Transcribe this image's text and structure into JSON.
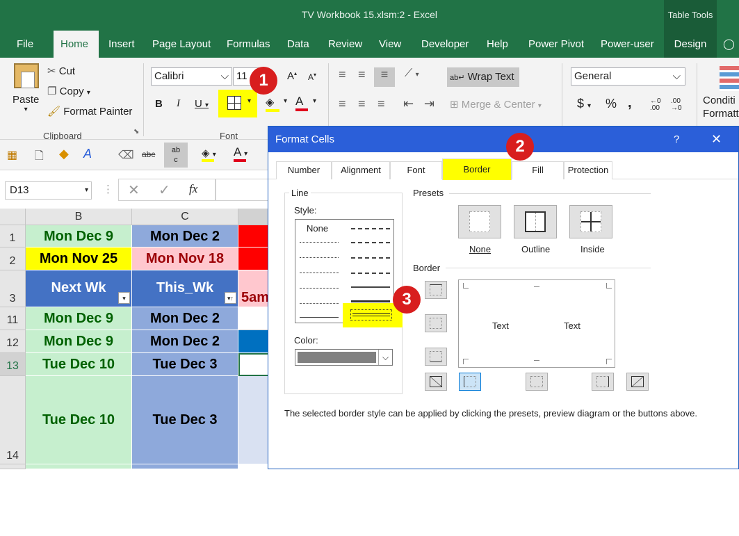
{
  "window": {
    "title": "TV Workbook 15.xlsm:2  -  Excel",
    "table_tools": "Table Tools"
  },
  "tabs": [
    "File",
    "Home",
    "Insert",
    "Page Layout",
    "Formulas",
    "Data",
    "Review",
    "View",
    "Developer",
    "Help",
    "Power Pivot",
    "Power-user",
    "Design"
  ],
  "clipboard": {
    "paste": "Paste",
    "cut": "Cut",
    "copy": "Copy",
    "format_painter": "Format Painter",
    "group": "Clipboard"
  },
  "font": {
    "name": "Calibri",
    "size": "11",
    "group": "Font"
  },
  "alignment": {
    "wrap_text": "Wrap Text",
    "merge_center": "Merge & Center"
  },
  "number": {
    "format": "General",
    "symbols": [
      "$",
      "%",
      ","
    ]
  },
  "styles": {
    "conditional": "Conditional Formatting",
    "cond_line1": "Conditi",
    "cond_line2": "Formatti"
  },
  "formula_bar": {
    "name_box": "D13",
    "fx": "fx"
  },
  "sheet": {
    "columns": [
      "B",
      "C"
    ],
    "rows": [
      {
        "num": "1",
        "b": "Mon Dec 9",
        "c": "Mon Dec 2"
      },
      {
        "num": "2",
        "b": "Mon Nov 25",
        "c": "Mon Nov 18"
      },
      {
        "num": "3",
        "b": "Next Wk",
        "c": "This_Wk",
        "d": "5am"
      },
      {
        "num": "11",
        "b": "Mon Dec 9",
        "c": "Mon Dec 2"
      },
      {
        "num": "12",
        "b": "Mon Dec 9",
        "c": "Mon Dec 2"
      },
      {
        "num": "13",
        "b": "Tue Dec 10",
        "c": "Tue Dec 3"
      },
      {
        "num": "14",
        "b": "Tue Dec 10",
        "c": "Tue Dec 3"
      }
    ]
  },
  "dialog": {
    "title": "Format Cells",
    "help": "?",
    "close": "✕",
    "tabs": [
      "Number",
      "Alignment",
      "Font",
      "Border",
      "Fill",
      "Protection"
    ],
    "line": "Line",
    "style": "Style:",
    "none_style": "None",
    "color": "Color:",
    "presets": "Presets",
    "preset_labels": [
      "None",
      "Outline",
      "Inside"
    ],
    "border": "Border",
    "preview_text": [
      "Text",
      "Text"
    ],
    "footer": "The selected border style can be applied by clicking the presets, preview diagram or the buttons above."
  },
  "annotations": [
    "1",
    "2",
    "3"
  ],
  "colors": {
    "excel_green": "#217346",
    "dialog_blue": "#2b5fd9",
    "highlight": "#ffff00",
    "badge_red": "#d81e1e"
  }
}
